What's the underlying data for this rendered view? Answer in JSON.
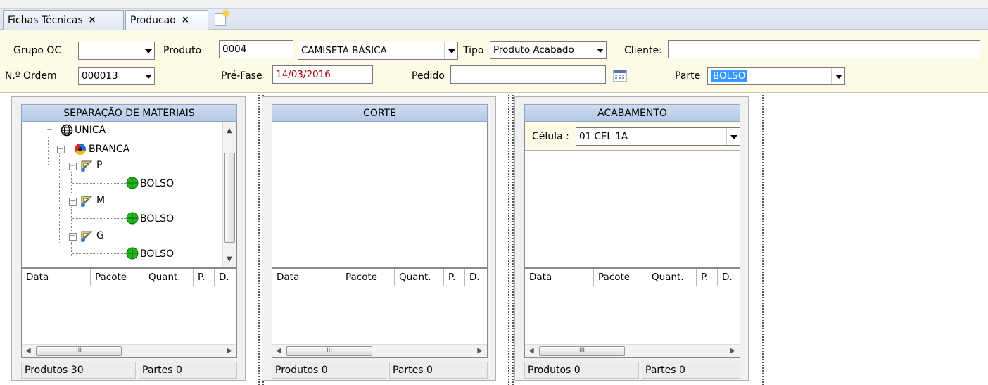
{
  "tabs": [
    {
      "label": "Fichas Técnicas"
    },
    {
      "label": "Producao"
    }
  ],
  "tab_close": "×",
  "form": {
    "grupo_oc_label": "Grupo OC",
    "grupo_oc_value": "",
    "produto_label": "Produto",
    "produto_code": "0004",
    "produto_name": "CAMISETA BÁSICA",
    "tipo_label": "Tipo",
    "tipo_value": "Produto Acabado",
    "cliente_label": "Cliente:",
    "cliente_value": "",
    "ordem_label": "N.º Ordem",
    "ordem_value": "000013",
    "prefase_label": "Pré-Fase",
    "prefase_value": "14/03/2016",
    "pedido_label": "Pedido",
    "pedido_value": "",
    "parte_label": "Parte",
    "parte_value": "BOLSO"
  },
  "panels": [
    {
      "title": "SEPARAÇÃO DE MATERIAIS",
      "produtos_label": "Produtos",
      "produtos_value": "30",
      "partes_label": "Partes",
      "partes_value": "0"
    },
    {
      "title": "CORTE",
      "produtos_label": "Produtos",
      "produtos_value": "0",
      "partes_label": "Partes",
      "partes_value": "0"
    },
    {
      "title": "ACABAMENTO",
      "produtos_label": "Produtos",
      "produtos_value": "0",
      "partes_label": "Partes",
      "partes_value": "0",
      "celula_label": "Célula :",
      "celula_value": "01 CEL 1A"
    }
  ],
  "grid_columns": [
    "Data",
    "Pacote",
    "Quant.",
    "P.",
    "D."
  ],
  "scroll_thumb_grip": "III",
  "tree": {
    "root": "UNICA",
    "color": "BRANCA",
    "sizes": [
      {
        "size": "P",
        "part": "BOLSO"
      },
      {
        "size": "M",
        "part": "BOLSO"
      },
      {
        "size": "G",
        "part": "BOLSO"
      }
    ]
  },
  "colors": {
    "accent": "#3399ff",
    "form_bg": "#fdfbe6",
    "header_blue": "#b5c8e4",
    "date_red": "#a00000"
  }
}
